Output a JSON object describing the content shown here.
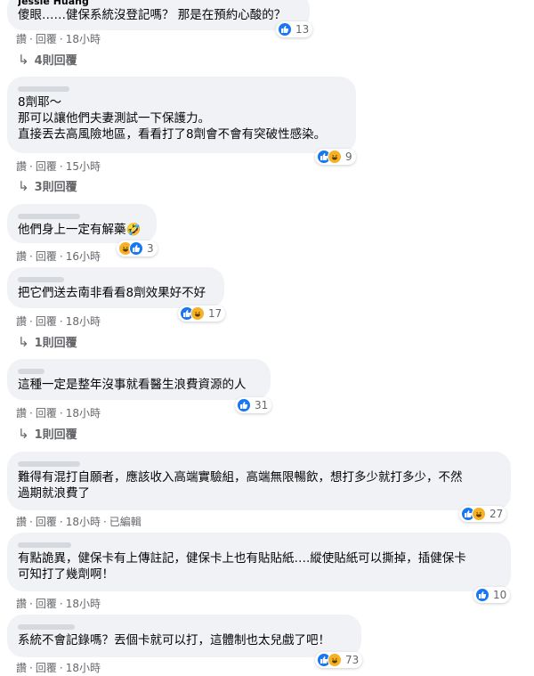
{
  "comments": [
    {
      "author": "Jessie Huang",
      "lines": [
        "傻眼……健保系統沒登記嗎？ 那是在預約心酸的？"
      ],
      "actions": {
        "like": "讚",
        "reply": "回覆",
        "time": "18小時"
      },
      "reactions": {
        "types": [
          "like"
        ],
        "count": "13"
      },
      "replies": "4則回覆"
    },
    {
      "lines": [
        "8劑耶～",
        "那可以讓他們夫妻測試一下保護力。",
        "直接丟去高風險地區，看看打了8劑會不會有突破性感染。"
      ],
      "actions": {
        "like": "讚",
        "reply": "回覆",
        "time": "15小時"
      },
      "reactions": {
        "types": [
          "like",
          "haha"
        ],
        "count": "9"
      },
      "replies": "3則回覆"
    },
    {
      "lines": [
        "他們身上一定有解藥🤣"
      ],
      "actions": {
        "like": "讚",
        "reply": "回覆",
        "time": "16小時"
      },
      "reactions": {
        "types": [
          "haha",
          "like"
        ],
        "count": "3"
      }
    },
    {
      "lines": [
        "把它們送去南非看看8劑效果好不好"
      ],
      "actions": {
        "like": "讚",
        "reply": "回覆",
        "time": "18小時"
      },
      "reactions": {
        "types": [
          "like",
          "haha"
        ],
        "count": "17"
      },
      "replies": "1則回覆"
    },
    {
      "lines": [
        "這種一定是整年沒事就看醫生浪費資源的人"
      ],
      "actions": {
        "like": "讚",
        "reply": "回覆",
        "time": "18小時"
      },
      "reactions": {
        "types": [
          "like"
        ],
        "count": "31"
      },
      "replies": "1則回覆"
    },
    {
      "lines": [
        "難得有混打自願者，應該收入高端實驗組，高端無限暢飲，想打多少就打多少，不然",
        "過期就浪費了"
      ],
      "actions": {
        "like": "讚",
        "reply": "回覆",
        "time": "18小時",
        "edited": "已編輯"
      },
      "reactions": {
        "types": [
          "like",
          "haha"
        ],
        "count": "27"
      }
    },
    {
      "lines": [
        "有點詭異，健保卡有上傳註記，健保卡上也有貼貼紙….縱使貼紙可以撕掉，插健保卡",
        "可知打了幾劑啊！"
      ],
      "actions": {
        "like": "讚",
        "reply": "回覆",
        "time": "18小時"
      },
      "reactions": {
        "types": [
          "like"
        ],
        "count": "10"
      }
    },
    {
      "lines": [
        "系統不會記錄嗎？丟個卡就可以打，這體制也太兒戲了吧！"
      ],
      "actions": {
        "like": "讚",
        "reply": "回覆",
        "time": "18小時"
      },
      "reactions": {
        "types": [
          "like",
          "haha"
        ],
        "count": "73"
      }
    }
  ],
  "icons": {
    "like": "thumbs-up-icon",
    "haha": "laughing-face-icon",
    "reply_arrow": "reply-arrow-icon"
  },
  "colors": {
    "like": "#1877f2",
    "haha": "#f7b125",
    "bubble": "#f0f2f5",
    "meta": "#65676b"
  }
}
